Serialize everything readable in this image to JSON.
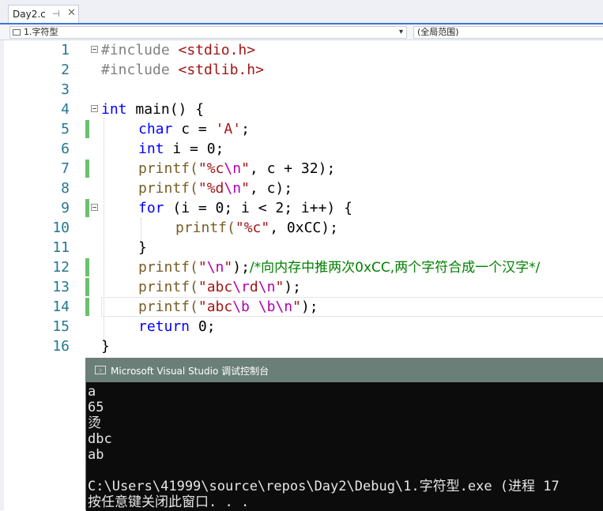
{
  "tab": {
    "title": "Day2.c",
    "pin_glyph": "⊣",
    "close_glyph": "✕"
  },
  "nav": {
    "member": "1.字符型",
    "scope": "(全局范围)",
    "arrow": "▾"
  },
  "code": {
    "line_numbers": [
      "1",
      "2",
      "3",
      "4",
      "5",
      "6",
      "7",
      "8",
      "9",
      "10",
      "11",
      "12",
      "13",
      "14",
      "15",
      "16"
    ],
    "l1_pp": "#include ",
    "l1_inc": "<stdio.h>",
    "l2_pp": "#include ",
    "l2_inc": "<stdlib.h>",
    "l4_kw": "int",
    "l4_rest": " main() {",
    "l5_kw": "char",
    "l5_mid": " c = ",
    "l5_str": "'A'",
    "l5_end": ";",
    "l6_kw": "int",
    "l6_rest": " i = 0;",
    "l7_fn": "printf(",
    "l7_s1": "\"%c",
    "l7_e1": "\\n",
    "l7_s2": "\"",
    "l7_rest": ", c + 32);",
    "l8_fn": "printf(",
    "l8_s1": "\"%d",
    "l8_e1": "\\n",
    "l8_s2": "\"",
    "l8_rest": ", c);",
    "l9_kw": "for",
    "l9_rest": " (i = 0; i < 2; i++) {",
    "l10_fn": "printf(",
    "l10_s1": "\"%c\"",
    "l10_rest": ", 0xCC);",
    "l11": "}",
    "l12_fn": "printf(",
    "l12_s1": "\"",
    "l12_e1": "\\n",
    "l12_s2": "\"",
    "l12_rest": ");",
    "l12_cmt": "/*向内存中推两次0xCC,两个字符合成一个汉字*/",
    "l13_fn": "printf(",
    "l13_s1": "\"abc",
    "l13_e1": "\\r",
    "l13_s2": "d",
    "l13_e2": "\\n",
    "l13_s3": "\"",
    "l13_rest": ");",
    "l14_fn": "printf(",
    "l14_s1": "\"abc",
    "l14_e1": "\\b",
    "l14_s2": " ",
    "l14_e2": "\\b",
    "l14_e3": "\\n",
    "l14_s3": "\"",
    "l14_rest": ");",
    "l15_kw": "return",
    "l15_rest": " 0;",
    "l16": "}"
  },
  "console": {
    "title": "Microsoft Visual Studio 调试控制台",
    "lines": [
      "a",
      "65",
      "烫",
      "dbc",
      "ab",
      "",
      "C:\\Users\\41999\\source\\repos\\Day2\\Debug\\1.字符型.exe (进程 17",
      "按任意键关闭此窗口. . ."
    ]
  },
  "colors": {
    "keyword": "#0000ff",
    "string": "#a31515",
    "escape": "#b000b0",
    "comment": "#008000",
    "line_number": "#237893",
    "change_bar": "#6cc16c"
  }
}
